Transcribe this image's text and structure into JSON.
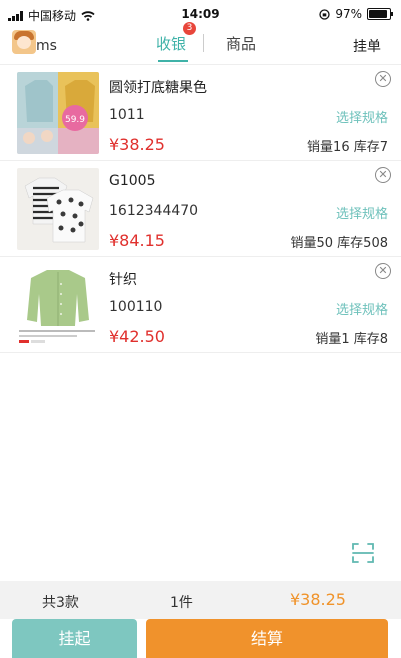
{
  "status_bar": {
    "carrier": "中国移动",
    "time": "14:09",
    "battery": "97%"
  },
  "header": {
    "username": "ms",
    "tabs": [
      {
        "label": "收银",
        "badge": "3",
        "active": true
      },
      {
        "label": "商品",
        "active": false
      }
    ],
    "right_link": "挂单"
  },
  "products": [
    {
      "name": "圆领打底糖果色",
      "code": "1011",
      "price": "¥38.25",
      "spec": "选择规格",
      "stock": "销量16  库存7",
      "thumb_sticker": "59.9"
    },
    {
      "name": "G1005",
      "code": "1612344470",
      "price": "¥84.15",
      "spec": "选择规格",
      "stock": "销量50  库存508"
    },
    {
      "name": "针织",
      "code": "100110",
      "price": "¥42.50",
      "spec": "选择规格",
      "stock": "销量1  库存8"
    }
  ],
  "summary": {
    "kinds": "共3款",
    "count": "1件",
    "total": "¥38.25"
  },
  "buttons": {
    "hold": "挂起",
    "checkout": "结算"
  },
  "colors": {
    "accent": "#3fb2a8",
    "price": "#e0302d",
    "checkout": "#f0922c",
    "hold": "#7ec7c0",
    "badge": "#e8463b"
  },
  "icons": {
    "remove": "close-circle-icon",
    "scan": "scan-icon",
    "avatar": "avatar-icon"
  }
}
